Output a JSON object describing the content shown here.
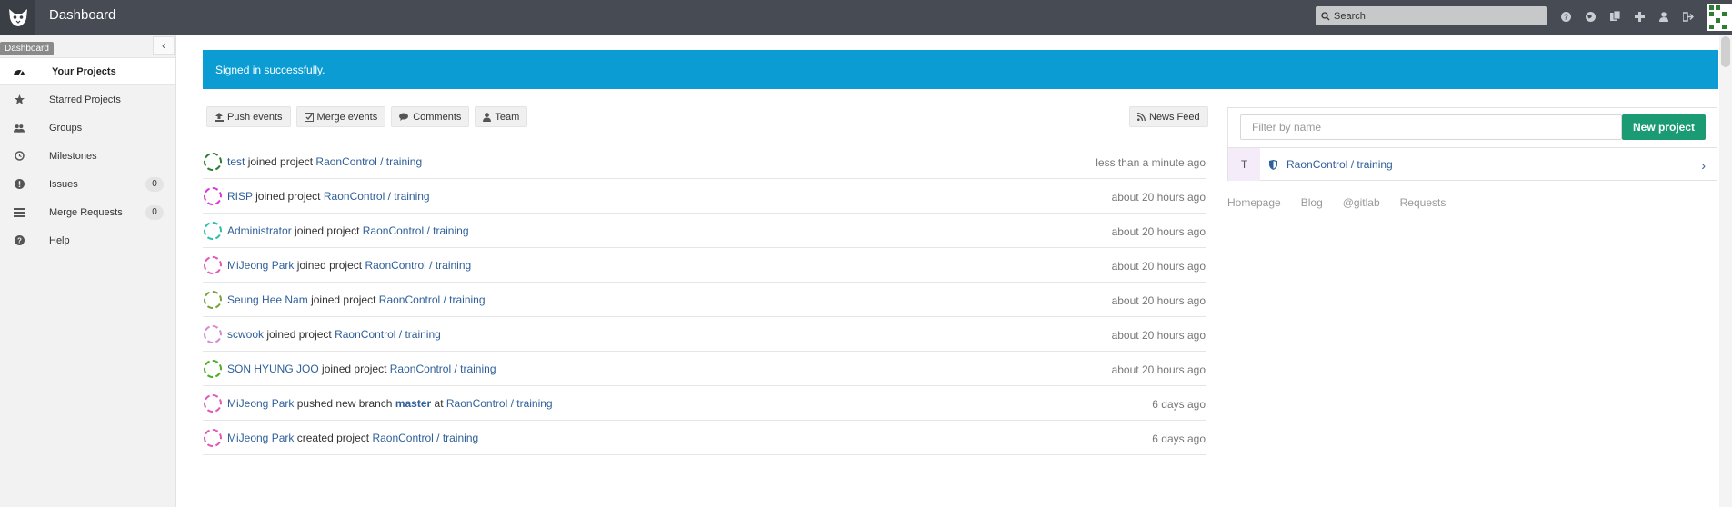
{
  "header": {
    "title": "Dashboard",
    "search_placeholder": "Search",
    "icons": [
      "help-icon",
      "globe-icon",
      "copy-icon",
      "plus-icon",
      "user-icon",
      "sign-out-icon"
    ]
  },
  "sidebar": {
    "tooltip": "Dashboard",
    "items": [
      {
        "label": "Your Projects",
        "icon": "dashboard-icon",
        "active": true
      },
      {
        "label": "Starred Projects",
        "icon": "star-icon"
      },
      {
        "label": "Groups",
        "icon": "group-icon"
      },
      {
        "label": "Milestones",
        "icon": "clock-icon"
      },
      {
        "label": "Issues",
        "icon": "exclamation-icon",
        "count": "0"
      },
      {
        "label": "Merge Requests",
        "icon": "list-icon",
        "count": "0"
      },
      {
        "label": "Help",
        "icon": "question-icon"
      }
    ]
  },
  "flash": {
    "message": "Signed in successfully."
  },
  "filters": [
    {
      "label": "Push events",
      "icon": "upload-icon"
    },
    {
      "label": "Merge events",
      "icon": "check-icon"
    },
    {
      "label": "Comments",
      "icon": "comments-icon"
    },
    {
      "label": "Team",
      "icon": "user-icon"
    }
  ],
  "news_feed": {
    "label": "News Feed"
  },
  "events": [
    {
      "user": "test",
      "action": "joined project",
      "project": "RaonControl / training",
      "time": "less than a minute ago",
      "color": "#2e7d32"
    },
    {
      "user": "RISP",
      "action": "joined project",
      "project": "RaonControl / training",
      "time": "about 20 hours ago",
      "color": "#d63bd6"
    },
    {
      "user": "Administrator",
      "action": "joined project",
      "project": "RaonControl / training",
      "time": "about 20 hours ago",
      "color": "#2fbfa6"
    },
    {
      "user": "MiJeong Park",
      "action": "joined project",
      "project": "RaonControl / training",
      "time": "about 20 hours ago",
      "color": "#e05ab8"
    },
    {
      "user": "Seung Hee Nam",
      "action": "joined project",
      "project": "RaonControl / training",
      "time": "about 20 hours ago",
      "color": "#7ba33c"
    },
    {
      "user": "scwook",
      "action": "joined project",
      "project": "RaonControl / training",
      "time": "about 20 hours ago",
      "color": "#d98ad2"
    },
    {
      "user": "SON HYUNG JOO",
      "action": "joined project",
      "project": "RaonControl / training",
      "time": "about 20 hours ago",
      "color": "#4caf20"
    },
    {
      "user": "MiJeong Park",
      "action": "pushed new branch",
      "branch": "master",
      "at": "at",
      "project": "RaonControl / training",
      "time": "6 days ago",
      "color": "#e05ab8"
    },
    {
      "user": "MiJeong Park",
      "action": "created project",
      "project": "RaonControl / training",
      "time": "6 days ago",
      "color": "#e05ab8"
    }
  ],
  "projects_panel": {
    "filter_placeholder": "Filter by name",
    "new_project_label": "New project",
    "projects": [
      {
        "letter": "T",
        "name": "RaonControl / training"
      }
    ]
  },
  "footer_links": [
    "Homepage",
    "Blog",
    "@gitlab",
    "Requests"
  ]
}
